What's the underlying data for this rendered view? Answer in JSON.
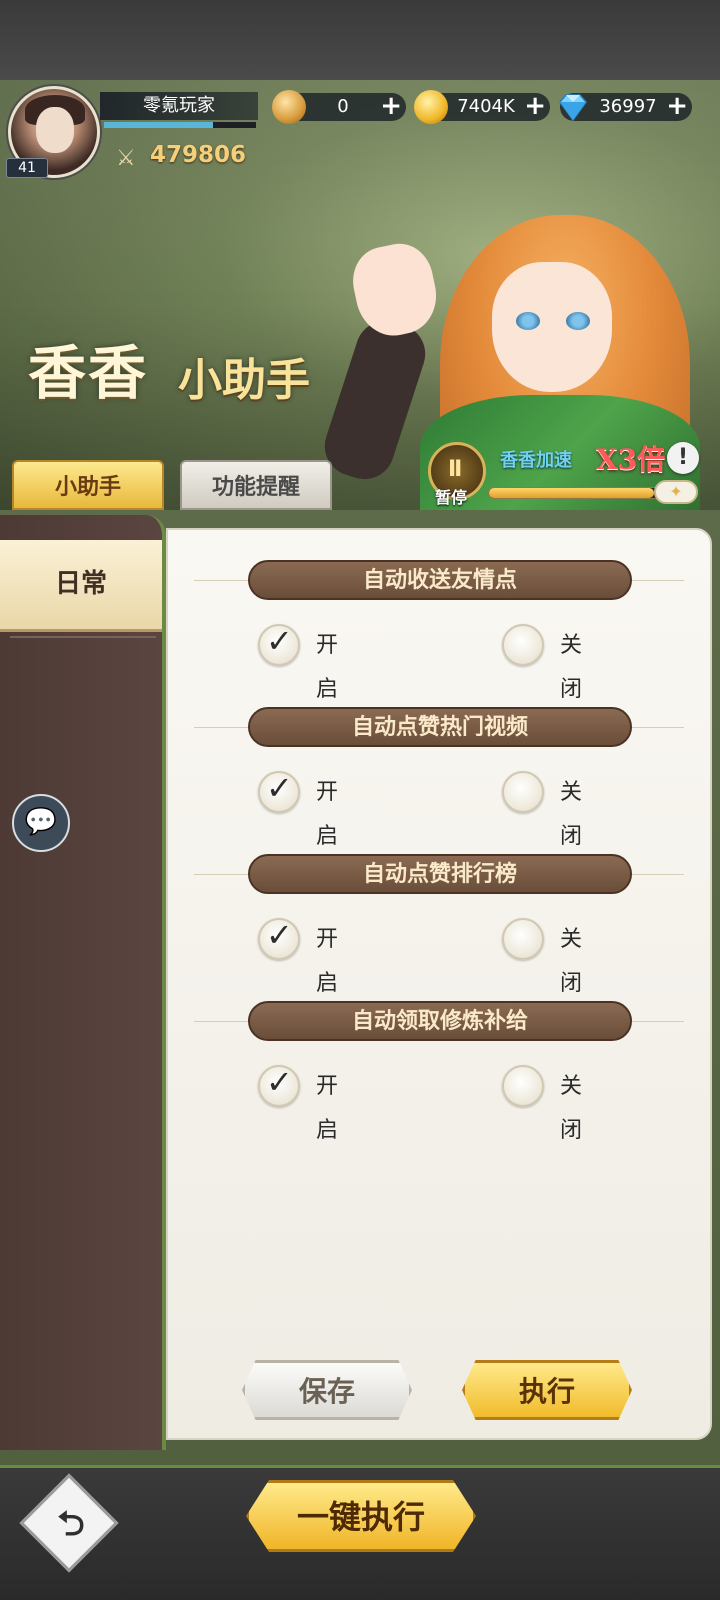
{
  "player": {
    "name": "零氪玩家",
    "level": "41",
    "power": "479806",
    "xp_fraction": 0.72
  },
  "currencies": [
    {
      "icon": "bronze-coin-icon",
      "value": "0",
      "plus": "+"
    },
    {
      "icon": "gold-coin-icon",
      "value": "7404K",
      "plus": "+"
    },
    {
      "icon": "diamond-icon",
      "value": "36997",
      "plus": "+"
    }
  ],
  "banner": {
    "title_big": "香香",
    "title_small": "小助手",
    "speed_label": "香香加速",
    "speed_multiplier": "X3倍",
    "info_icon": "!",
    "pause_label": "暂停",
    "pause_glyph": "II",
    "progress_fraction": 0.8,
    "knob_glyph": "✦"
  },
  "tabs": [
    {
      "label": "小助手",
      "active": true
    },
    {
      "label": "功能提醒",
      "active": false
    }
  ],
  "sidebar": {
    "items": [
      {
        "label": "日常",
        "active": true
      }
    ],
    "chat_icon": "💬"
  },
  "sections": [
    {
      "title": "自动收送友情点",
      "on_label": "开启",
      "off_label": "关闭",
      "selected": "on"
    },
    {
      "title": "自动点赞热门视频",
      "on_label": "开启",
      "off_label": "关闭",
      "selected": "on"
    },
    {
      "title": "自动点赞排行榜",
      "on_label": "开启",
      "off_label": "关闭",
      "selected": "on"
    },
    {
      "title": "自动领取修炼补给",
      "on_label": "开启",
      "off_label": "关闭",
      "selected": "on"
    }
  ],
  "actions": {
    "save_label": "保存",
    "execute_label": "执行",
    "one_key_label": "一键执行",
    "back_glyph": "⮌"
  },
  "colors": {
    "accent_gold": "#f0b626",
    "speed_red": "#ff5a5a",
    "speed_blue": "#6fd2ef",
    "sidebar_brown": "#4d3a35"
  }
}
